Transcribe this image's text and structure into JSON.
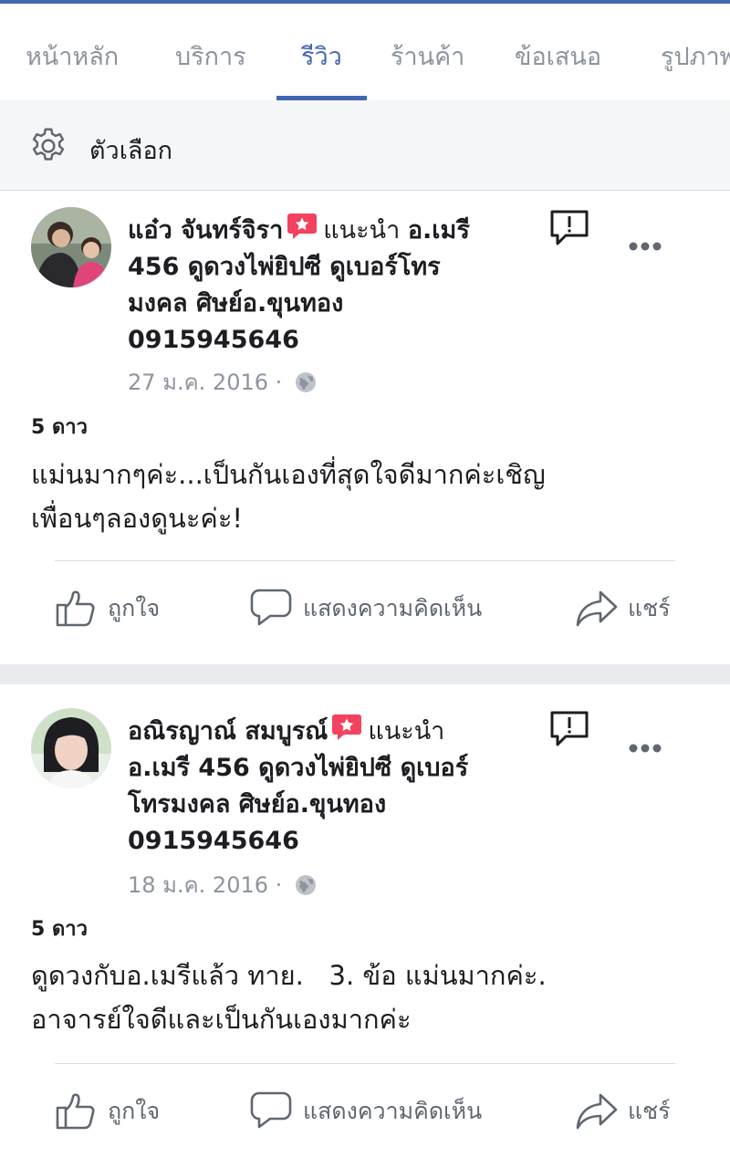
{
  "tabs": [
    {
      "label": "หน้าหลัก"
    },
    {
      "label": "บริการ"
    },
    {
      "label": "รีวิว"
    },
    {
      "label": "ร้านค้า"
    },
    {
      "label": "ข้อเสนอ"
    },
    {
      "label": "รูปภาพ"
    }
  ],
  "active_tab": "รีวิว",
  "options": {
    "label": "ตัวเลือก",
    "icon": "gear-icon"
  },
  "reviews": [
    {
      "reviewer": "แอ๋ว จันทร์จิรา",
      "recommends": "แนะนำ",
      "page_line1": "อ.เมรี",
      "page_line2": "456 ดูดวงไพ่ยิปซี ดูเบอร์โทร",
      "page_line3": "มงคล ศิษย์อ.ขุนทอง",
      "page_line4": "0915945646",
      "date": "27 ม.ค. 2016 ·",
      "stars": "5 ดาว",
      "text_line1": "แม่นมากๆค่ะ...เป็นกันเองที่สุดใจดีมากค่ะเชิญ",
      "text_line2": "เพื่อนๆลองดูนะค่ะ!",
      "actions": {
        "like": "ถูกใจ",
        "comment": "แสดงความคิดเห็น",
        "share": "แชร์"
      }
    },
    {
      "reviewer": "อณิรญาณ์ สมบูรณ์",
      "recommends": "แนะนำ",
      "page_line1": "อ.เมรี 456 ดูดวงไพ่ยิปซี ดูเบอร์",
      "page_line2": "โทรมงคล ศิษย์อ.ขุนทอง",
      "page_line3": "0915945646",
      "date": "18 ม.ค. 2016 ·",
      "stars": "5 ดาว",
      "text_line1": "ดูดวงกับอ.เมรีแล้ว ทาย.   3. ข้อ แม่นมากค่ะ.",
      "text_line2": "อาจารย์ใจดีและเป็นกันเองมากค่ะ",
      "actions": {
        "like": "ถูกใจ",
        "comment": "แสดงความคิดเห็น",
        "share": "แชร์"
      }
    }
  ],
  "colors": {
    "accent": "#4267b2",
    "recommend_badge": "#f3425f",
    "muted": "#8d949e"
  }
}
